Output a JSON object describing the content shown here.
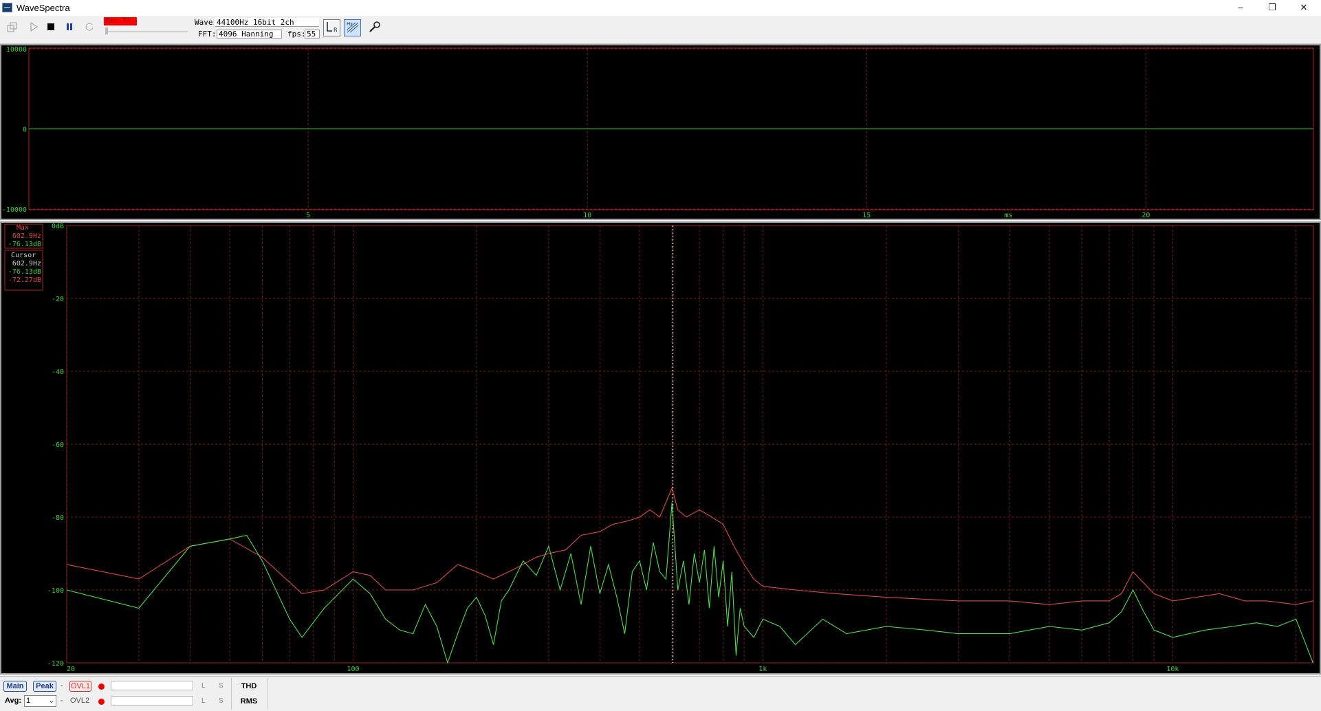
{
  "window": {
    "title": "WaveSpectra",
    "minimize_glyph": "–",
    "restore_glyph": "❐",
    "close_glyph": "✕"
  },
  "toolbar": {
    "rec_badge": "Rec Tr",
    "wave_label": "Wave:",
    "wave_value": "44100Hz 16bit 2ch",
    "fft_label": "FFT:",
    "fft_value": "4096 Hanning",
    "fps_label": "fps:",
    "fps_value": "55",
    "icons": [
      "copy-icon",
      "play-icon",
      "stop-icon",
      "pause-icon",
      "loop-icon",
      "lr-channel-icon",
      "hz-scale-icon",
      "settings-wrench-icon"
    ]
  },
  "wave_panel": {
    "y_ticks": [
      "10000",
      "0",
      "-10000"
    ],
    "x_ticks": [
      "5",
      "10",
      "15",
      "20"
    ],
    "x_unit": "ms"
  },
  "spectrum_panel": {
    "y_ticks": [
      "0dB",
      "-20",
      "-40",
      "-60",
      "-80",
      "-100",
      "-120"
    ],
    "x_ticks": [
      "20",
      "100",
      "1k",
      "10k"
    ],
    "max_box": {
      "title": "Max",
      "freq": "602.9Hz",
      "level": "-76.13dB"
    },
    "cursor_box": {
      "title": "Cursor",
      "freq": "602.9Hz",
      "level_left": "-76.13dB",
      "level_right": "-72.27dB"
    }
  },
  "chart_data": [
    {
      "type": "line",
      "title": "",
      "xlabel": "ms",
      "ylabel": "",
      "xlim": [
        0,
        23
      ],
      "ylim": [
        -10000,
        10000
      ],
      "x_ticks": [
        5,
        10,
        15,
        20
      ],
      "y_ticks": [
        10000,
        0,
        -10000
      ],
      "grid": true,
      "series": [
        {
          "x": [
            0,
            23
          ],
          "y": [
            0,
            0
          ]
        }
      ]
    },
    {
      "type": "line",
      "title": "",
      "xlabel": "",
      "ylabel": "",
      "x_scale": "log",
      "xlim": [
        20,
        22050
      ],
      "ylim": [
        -120,
        0
      ],
      "x_ticks": [
        "20",
        "100",
        "1k",
        "10k"
      ],
      "y_ticks": [
        0,
        -20,
        -40,
        -60,
        -80,
        -100,
        -120
      ],
      "grid": true,
      "cursor_freq": 602.9,
      "series": [
        {
          "color": "#e04848",
          "x": [
            20,
            30,
            40,
            50,
            60,
            75,
            85,
            100,
            110,
            120,
            140,
            160,
            180,
            200,
            220,
            250,
            280,
            300,
            330,
            360,
            400,
            430,
            470,
            500,
            530,
            560,
            600,
            620,
            650,
            700,
            750,
            800,
            850,
            900,
            950,
            1000,
            1200,
            1500,
            2000,
            3000,
            4000,
            5000,
            6000,
            7000,
            7500,
            8000,
            9000,
            10000,
            13000,
            15000,
            17000,
            20000,
            22000
          ],
          "y": [
            -93,
            -97,
            -88,
            -86,
            -91,
            -101,
            -100,
            -95,
            -96,
            -100,
            -100,
            -98,
            -93,
            -95,
            -97,
            -94,
            -91,
            -90,
            -89,
            -85,
            -84,
            -82,
            -81,
            -80,
            -78,
            -80,
            -72,
            -78,
            -80,
            -78,
            -80,
            -82,
            -88,
            -93,
            -97,
            -99,
            -100,
            -101,
            -102,
            -103,
            -103,
            -104,
            -103,
            -103,
            -101,
            -95,
            -101,
            -103,
            -101,
            -103,
            -103,
            -104,
            -103
          ]
        },
        {
          "color": "#49e049",
          "x": [
            20,
            30,
            40,
            50,
            55,
            60,
            70,
            75,
            85,
            100,
            110,
            120,
            130,
            140,
            150,
            160,
            170,
            180,
            190,
            200,
            210,
            220,
            230,
            240,
            260,
            280,
            300,
            320,
            340,
            360,
            380,
            400,
            420,
            440,
            460,
            480,
            500,
            520,
            540,
            560,
            580,
            600,
            603,
            610,
            620,
            640,
            660,
            680,
            700,
            720,
            740,
            760,
            780,
            800,
            820,
            840,
            860,
            880,
            900,
            950,
            1000,
            1100,
            1200,
            1400,
            1600,
            2000,
            2500,
            3000,
            4000,
            5000,
            6000,
            7000,
            7500,
            8000,
            8500,
            9000,
            10000,
            12000,
            14000,
            16000,
            18000,
            20000,
            22000
          ],
          "y": [
            -100,
            -105,
            -88,
            -86,
            -85,
            -92,
            -108,
            -113,
            -105,
            -97,
            -101,
            -108,
            -111,
            -112,
            -104,
            -110,
            -120,
            -112,
            -105,
            -102,
            -107,
            -115,
            -103,
            -100,
            -92,
            -96,
            -88,
            -100,
            -90,
            -104,
            -88,
            -101,
            -93,
            -102,
            -112,
            -95,
            -92,
            -100,
            -87,
            -95,
            -97,
            -76,
            -80,
            -88,
            -100,
            -92,
            -104,
            -90,
            -98,
            -89,
            -105,
            -88,
            -102,
            -92,
            -110,
            -95,
            -118,
            -105,
            -110,
            -113,
            -108,
            -110,
            -115,
            -108,
            -112,
            -110,
            -111,
            -112,
            -112,
            -110,
            -111,
            -109,
            -106,
            -100,
            -106,
            -111,
            -113,
            -111,
            -110,
            -109,
            -110,
            -108,
            -120
          ]
        }
      ]
    }
  ],
  "status": {
    "main_btn": "Main",
    "peak_btn": "Peak",
    "dash": "-",
    "ovl1": "OVL1",
    "ovl2": "OVL2",
    "l": "L",
    "s": "S",
    "avg_label": "Avg:",
    "avg_value": "1",
    "thd_btn": "THD",
    "rms_btn": "RMS"
  }
}
